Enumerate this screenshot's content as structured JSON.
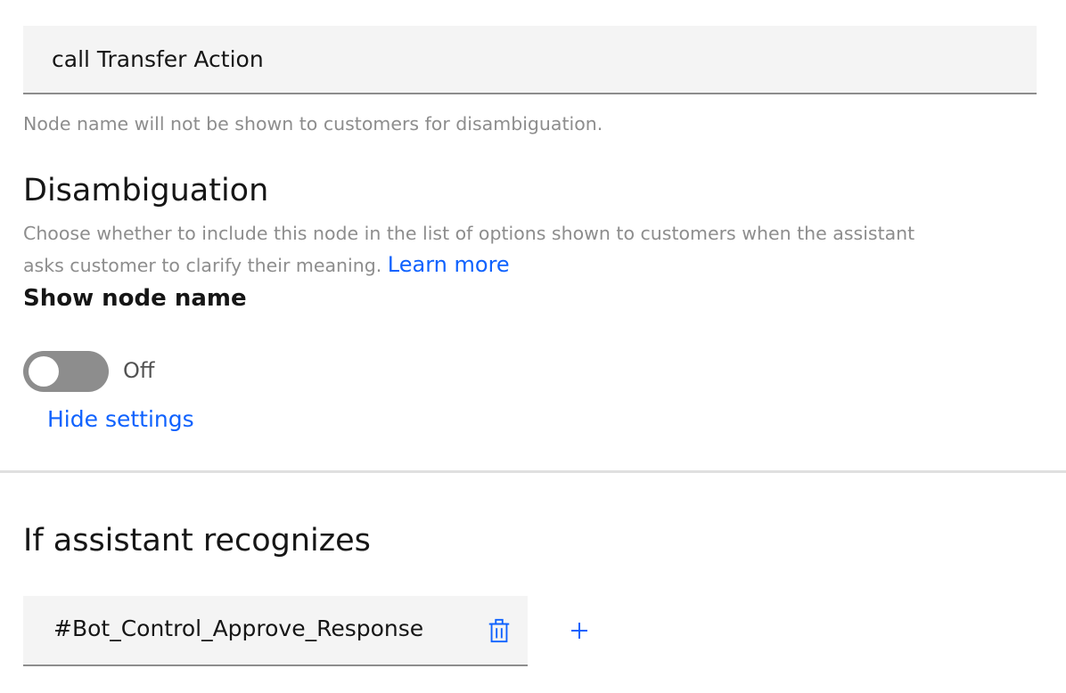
{
  "node_name": {
    "value": "call Transfer Action",
    "helper": "Node name will not be shown to customers for disambiguation."
  },
  "disambiguation": {
    "heading": "Disambiguation",
    "description_line1": "Choose whether to include this node in the list of options shown to customers when the assistant",
    "description_line2": "asks customer to clarify their meaning.",
    "learn_more": "Learn more",
    "toggle_label": "Show node name",
    "toggle_state": "Off",
    "toggle_on": false,
    "hide_settings": "Hide settings"
  },
  "recognizes": {
    "heading": "If assistant recognizes",
    "condition": "#Bot_Control_Approve_Response"
  },
  "icons": {
    "delete": "trash-icon",
    "add": "plus-icon"
  },
  "colors": {
    "link": "#0f62fe",
    "toggle_off": "#8d8d8d",
    "field_bg": "#f4f4f4"
  }
}
